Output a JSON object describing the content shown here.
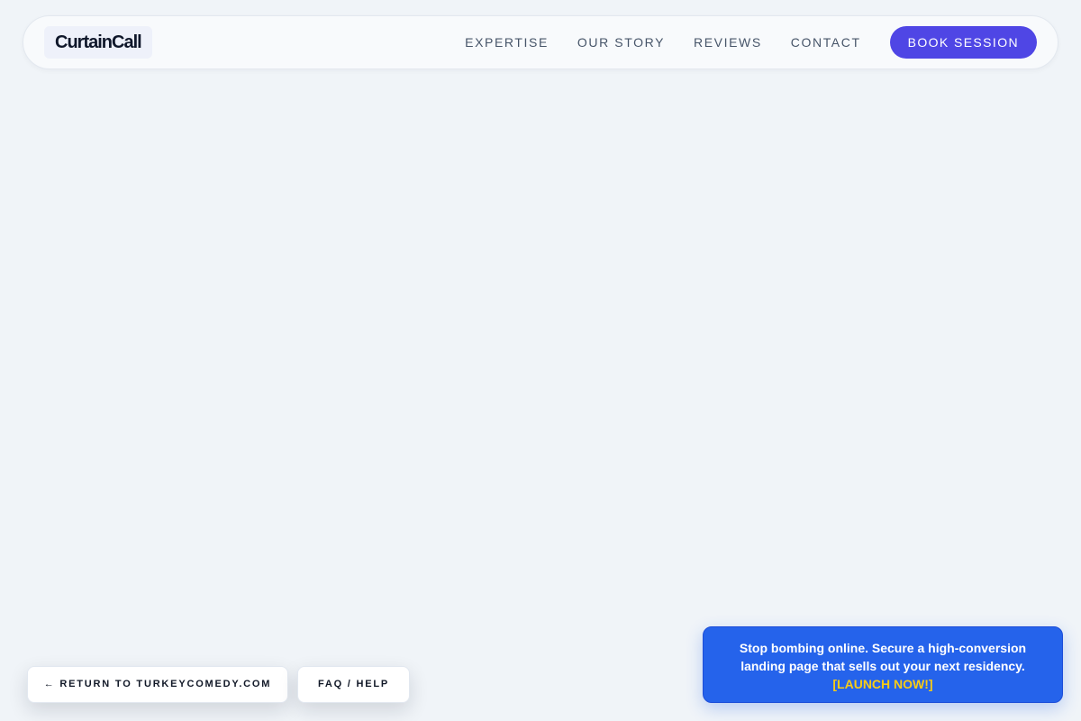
{
  "brand": {
    "name": "CurtainCall"
  },
  "nav": {
    "links": [
      {
        "label": "EXPERTISE"
      },
      {
        "label": "OUR STORY"
      },
      {
        "label": "REVIEWS"
      },
      {
        "label": "CONTACT"
      }
    ],
    "cta_label": "BOOK SESSION"
  },
  "footer_actions": {
    "return_label": "← RETURN TO TURKEYCOMEDY.COM",
    "faq_label": "FAQ / HELP"
  },
  "promo": {
    "text": "Stop bombing online. Secure a high-conversion landing page that sells out your next residency.",
    "cta": "[LAUNCH NOW!]"
  },
  "colors": {
    "background": "#f0f4f8",
    "accent": "#4f46e5",
    "promo_bg": "#2563eb",
    "promo_cta": "#facc15"
  }
}
